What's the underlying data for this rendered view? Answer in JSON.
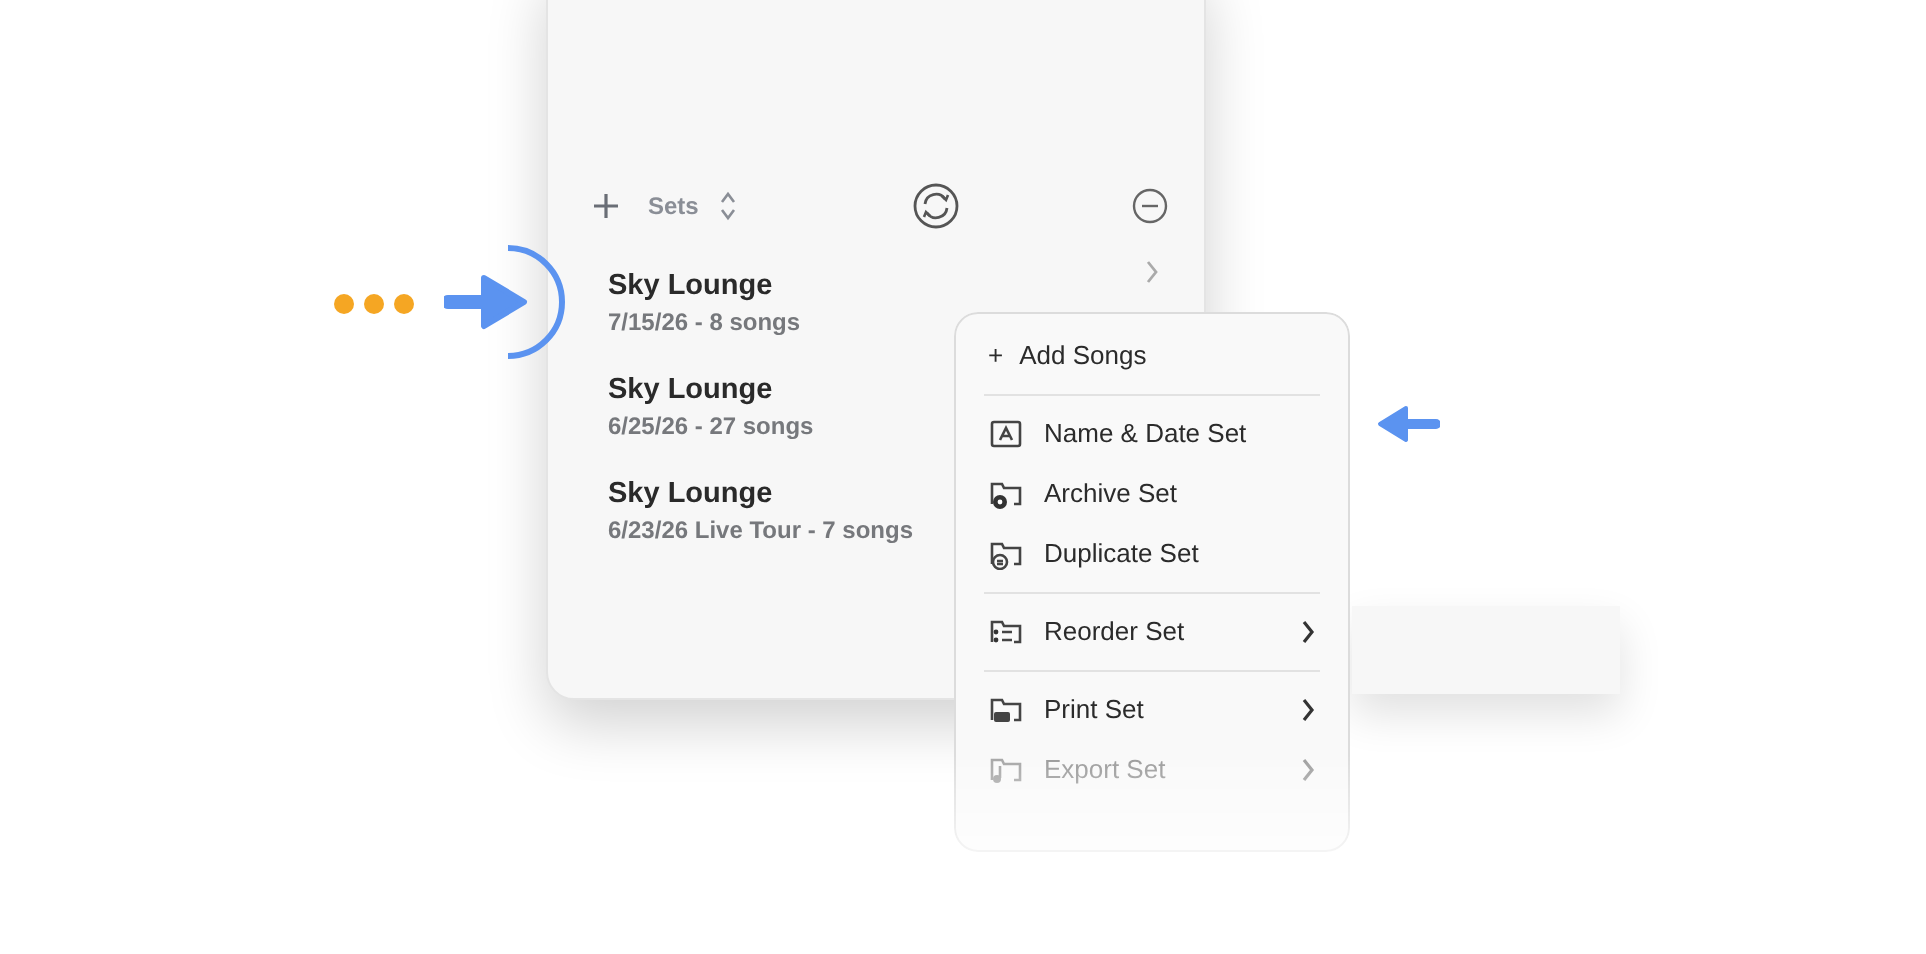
{
  "toolbar": {
    "title": "Sets"
  },
  "sets": [
    {
      "name": "Sky Lounge",
      "detail": "7/15/26 - 8 songs"
    },
    {
      "name": "Sky Lounge",
      "detail": "6/25/26 - 27 songs"
    },
    {
      "name": "Sky Lounge",
      "detail": "6/23/26 Live Tour - 7 songs"
    }
  ],
  "menu": {
    "items": [
      {
        "kind": "item",
        "symbol": "+",
        "label": "Add Songs",
        "submenu": false
      },
      {
        "kind": "divider"
      },
      {
        "kind": "item",
        "label": "Name & Date Set",
        "submenu": false
      },
      {
        "kind": "item",
        "label": "Archive Set",
        "submenu": false
      },
      {
        "kind": "item",
        "label": "Duplicate Set",
        "submenu": false
      },
      {
        "kind": "divider"
      },
      {
        "kind": "item",
        "label": "Reorder Set",
        "submenu": true
      },
      {
        "kind": "divider"
      },
      {
        "kind": "item",
        "label": "Print Set",
        "submenu": true
      },
      {
        "kind": "item",
        "label": "Export Set",
        "submenu": true
      }
    ]
  }
}
